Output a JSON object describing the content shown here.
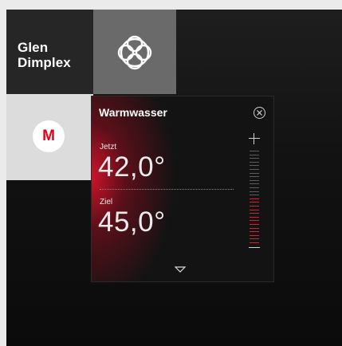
{
  "brand": {
    "line1": "Glen",
    "line2": "Dimplex"
  },
  "knot_tile": {
    "icon": "celtic-knot-icon"
  },
  "m_tile": {
    "letter": "M",
    "color": "#e2001a"
  },
  "panel": {
    "title": "Warmwasser",
    "current": {
      "label": "Jetzt",
      "value": "42,0°"
    },
    "target": {
      "label": "Ziel",
      "value": "45,0°"
    },
    "scale": {
      "total_ticks": 26,
      "active_ticks": 13
    },
    "accent_color": "#d52135"
  }
}
